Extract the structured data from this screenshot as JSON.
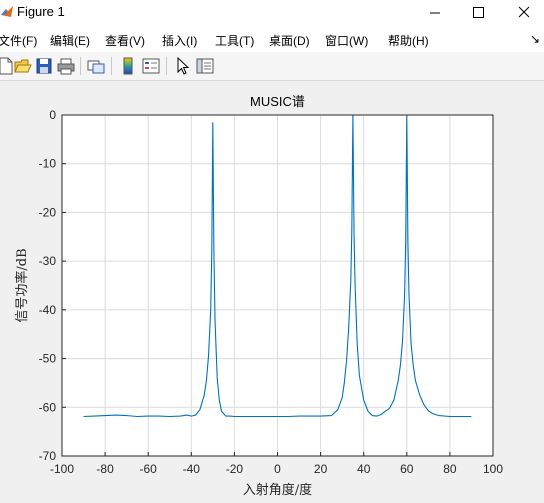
{
  "window": {
    "title": "Figure 1"
  },
  "menu": {
    "items": [
      "文件(F)",
      "编辑(E)",
      "查看(V)",
      "插入(I)",
      "工具(T)",
      "桌面(D)",
      "窗口(W)",
      "帮助(H)"
    ]
  },
  "toolbar": {
    "buttons": [
      "new-figure-icon",
      "open-file-icon",
      "save-icon",
      "print-icon",
      "link-plot-icon",
      "insert-colorbar-icon",
      "insert-legend-icon",
      "edit-plot-icon",
      "property-inspector-icon"
    ]
  },
  "colors": {
    "line": "#0072bd",
    "grid": "#dcdcdc",
    "axes_bg": "#ffffff",
    "figure_bg": "#f0f0f0"
  },
  "chart_data": {
    "type": "line",
    "title": "MUSIC谱",
    "xlabel": "入射角度/度",
    "ylabel": "信号功率/dB",
    "xlim": [
      -100,
      100
    ],
    "ylim": [
      -70,
      0
    ],
    "xticks": [
      -100,
      -80,
      -60,
      -40,
      -20,
      0,
      20,
      40,
      60,
      80,
      100
    ],
    "yticks": [
      0,
      -10,
      -20,
      -30,
      -40,
      -50,
      -60,
      -70
    ],
    "grid": true,
    "x": [
      -90,
      -85,
      -80,
      -75,
      -70,
      -65,
      -60,
      -55,
      -50,
      -45,
      -42,
      -40,
      -38,
      -36,
      -34,
      -33,
      -32,
      -31,
      -30.5,
      -30,
      -29.5,
      -29,
      -28,
      -27,
      -26,
      -24,
      -22,
      -20,
      -15,
      -10,
      -5,
      0,
      5,
      10,
      15,
      20,
      25,
      28,
      30,
      31,
      32,
      33,
      34,
      34.5,
      35,
      35.5,
      36,
      37,
      38,
      40,
      42,
      44,
      46,
      48,
      50,
      52,
      54,
      56,
      57,
      58,
      59,
      59.5,
      60,
      60.5,
      61,
      62,
      63,
      64,
      66,
      68,
      70,
      72,
      75,
      80,
      85,
      90
    ],
    "series": [
      {
        "values": [
          -61.9,
          -61.8,
          -61.7,
          -61.6,
          -61.7,
          -61.9,
          -61.8,
          -61.8,
          -61.9,
          -61.8,
          -61.6,
          -61.8,
          -61.6,
          -60.5,
          -57.5,
          -54.5,
          -49.5,
          -40,
          -28,
          -1.5,
          -28,
          -42,
          -54,
          -58.5,
          -60.8,
          -61.8,
          -61.8,
          -61.9,
          -61.9,
          -61.9,
          -61.9,
          -61.9,
          -61.9,
          -61.8,
          -61.8,
          -61.8,
          -61.7,
          -60.5,
          -58,
          -55,
          -50.5,
          -44,
          -34,
          -24,
          0,
          -24,
          -35,
          -47,
          -53.5,
          -58.5,
          -60.8,
          -61.7,
          -61.8,
          -61.5,
          -60.8,
          -60.2,
          -58.5,
          -54.5,
          -51.5,
          -46.5,
          -37,
          -26,
          0,
          -26,
          -37,
          -47,
          -51.5,
          -54.5,
          -57.5,
          -59.5,
          -60.7,
          -61.3,
          -61.7,
          -61.9,
          -61.9,
          -61.9
        ]
      }
    ]
  }
}
